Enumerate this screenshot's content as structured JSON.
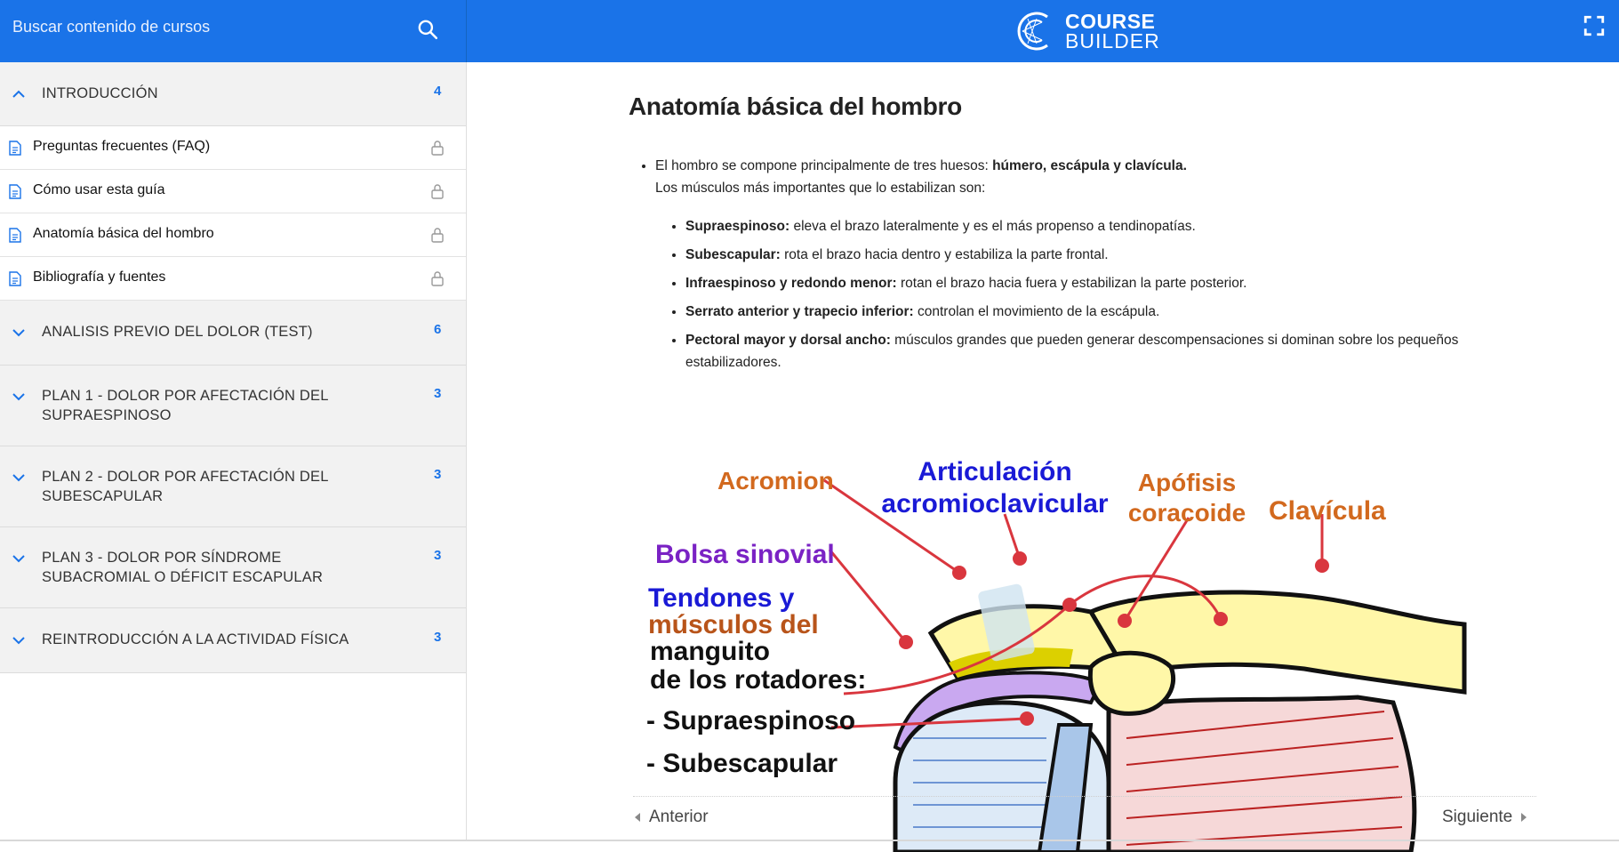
{
  "search": {
    "placeholder": "Buscar contenido de cursos"
  },
  "logo": {
    "line1": "COURSE",
    "line2": "BUILDER"
  },
  "sidebar": {
    "sections": [
      {
        "title": "INTRODUCCIÓN",
        "count": "4",
        "expanded": true,
        "lessons": [
          {
            "label": "Preguntas frecuentes (FAQ)"
          },
          {
            "label": "Cómo usar esta guía"
          },
          {
            "label": "Anatomía básica del hombro"
          },
          {
            "label": "Bibliografía y fuentes"
          }
        ]
      },
      {
        "title": "ANALISIS PREVIO DEL DOLOR (TEST)",
        "count": "6"
      },
      {
        "title": "PLAN 1 - DOLOR POR AFECTACIÓN DEL SUPRAESPINOSO",
        "count": "3"
      },
      {
        "title": "PLAN 2 - DOLOR POR AFECTACIÓN DEL SUBESCAPULAR",
        "count": "3"
      },
      {
        "title": "PLAN 3 - DOLOR POR SÍNDROME SUBACROMIAL O DÉFICIT ESCAPULAR",
        "count": "3"
      },
      {
        "title": "REINTRODUCCIÓN A LA ACTIVIDAD FÍSICA",
        "count": "3"
      }
    ]
  },
  "main": {
    "title": "Anatomía básica del hombro",
    "intro_text": "El hombro se compone principalmente de tres huesos: ",
    "intro_bold": "húmero, escápula y clavícula.",
    "intro_line2": "Los músculos más importantes que lo estabilizan son:",
    "muscles": [
      {
        "name": "Supraespinoso:",
        "desc": " eleva el brazo lateralmente y es el más propenso a tendinopatías."
      },
      {
        "name": "Subescapular:",
        "desc": " rota el brazo hacia dentro y estabiliza la parte frontal."
      },
      {
        "name": "Infraespinoso y redondo menor:",
        "desc": " rotan el brazo hacia fuera y estabilizan la parte posterior."
      },
      {
        "name": "Serrato anterior y trapecio inferior:",
        "desc": " controlan el movimiento de la escápula."
      },
      {
        "name": "Pectoral mayor y dorsal ancho:",
        "desc": " músculos grandes que pueden generar descompensaciones si dominan sobre los pequeños estabilizadores."
      }
    ],
    "figure_labels": {
      "acromion": "Acromion",
      "articulacion1": "Articulación",
      "articulacion2": "acromioclavicular",
      "apofisis1": "Apófisis",
      "apofisis2": "coracoide",
      "clavicula": "Clavícula",
      "bolsa": "Bolsa sinovial",
      "tendones1": "Tendones y",
      "tendones2": "músculos del",
      "tendones3": "manguito",
      "tendones4": "de los rotadores:",
      "supra": "- Supraespinoso",
      "sub": "- Subescapular"
    },
    "prev_label": "Anterior",
    "next_label": "Siguiente"
  },
  "colors": {
    "accent": "#1a73e8",
    "label_orange": "#d2691e",
    "label_blue": "#1a1ad6",
    "label_purple": "#7a22c4",
    "pin_red": "#d9363e"
  }
}
